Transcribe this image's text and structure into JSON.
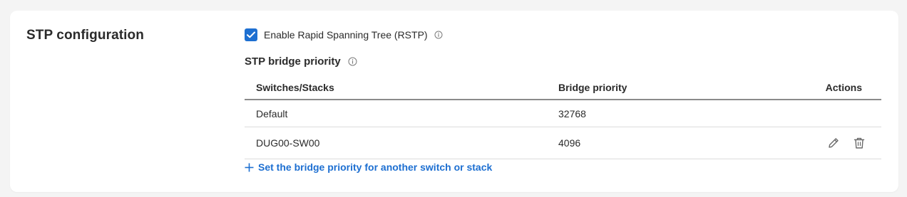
{
  "section": {
    "title": "STP configuration"
  },
  "rstp": {
    "label": "Enable Rapid Spanning Tree (RSTP)",
    "checked": true
  },
  "bridge_priority": {
    "heading": "STP bridge priority",
    "columns": {
      "switches": "Switches/Stacks",
      "priority": "Bridge priority",
      "actions": "Actions"
    },
    "rows": [
      {
        "switch": "Default",
        "priority": "32768"
      },
      {
        "switch": "DUG00-SW00",
        "priority": "4096"
      }
    ],
    "add_label": "Set the bridge priority for another switch or stack"
  },
  "colors": {
    "accent": "#1d6fd1",
    "text": "#2b2b2b",
    "background": "#f4f4f4",
    "card": "#ffffff"
  },
  "icons": {
    "checkbox": "checkmark-icon",
    "info": "info-icon",
    "edit": "pencil-icon",
    "delete": "trash-icon",
    "add": "plus-icon"
  }
}
